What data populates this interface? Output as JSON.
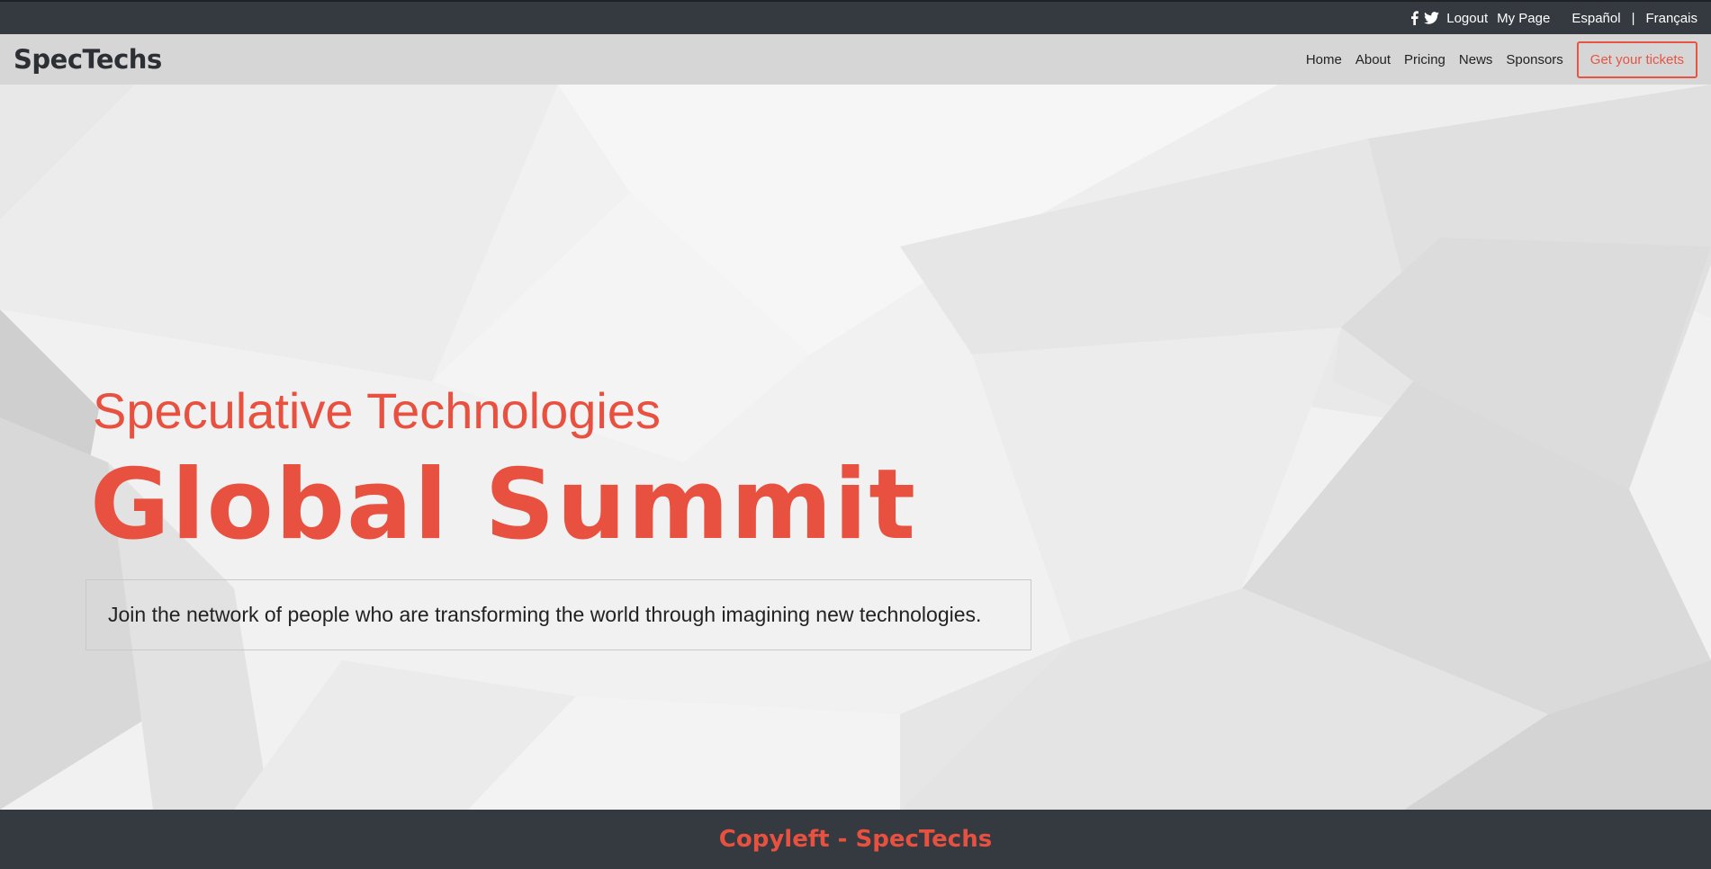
{
  "topbar": {
    "social": [
      "facebook-icon",
      "twitter-icon"
    ],
    "logout": "Logout",
    "my_page": "My Page",
    "lang_es": "Español",
    "separator": "|",
    "lang_fr": "Français"
  },
  "navbar": {
    "brand": "SpecTechs",
    "items": [
      "Home",
      "About",
      "Pricing",
      "News",
      "Sponsors"
    ],
    "cta": "Get your tickets"
  },
  "hero": {
    "subtitle": "Speculative Technologies",
    "title": "Global Summit",
    "tagline": "Join the network of people who are transforming the world through imagining new technologies."
  },
  "footer": {
    "text": "Copyleft - SpecTechs"
  },
  "colors": {
    "accent": "#e8503f",
    "dark": "#343a40",
    "navbar_bg": "#d6d6d6"
  }
}
